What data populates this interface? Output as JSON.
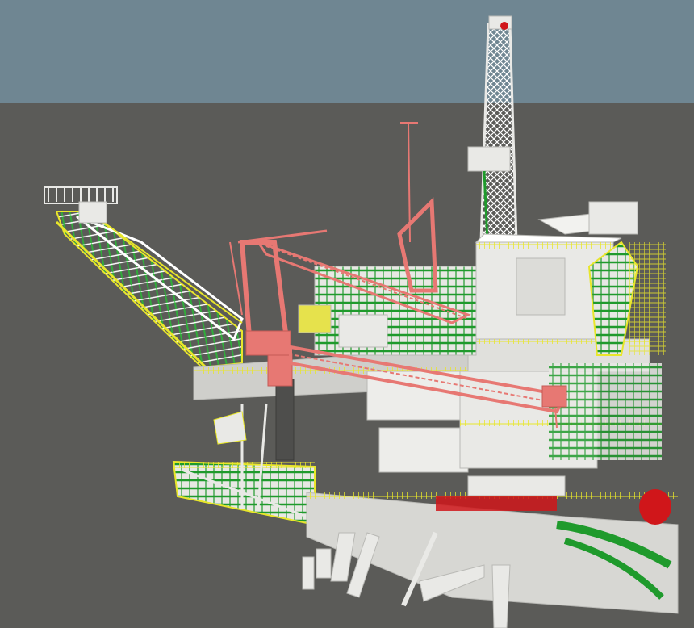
{
  "viewport": {
    "sky_color": "#6f8692",
    "ground_color": "#5b5b58"
  },
  "palette": {
    "structure": "#e9e9e6",
    "structure_shadow": "#b9b9b5",
    "railing": "#e8e62a",
    "piping": "#1f9a2c",
    "crane": "#e77873",
    "equipment_yellow": "#e6e24c",
    "vessel_red": "#d0161a"
  },
  "objects": [
    {
      "id": "drilling-derrick",
      "icon": "lattice-tower"
    },
    {
      "id": "flare-boom",
      "icon": "truss-boom"
    },
    {
      "id": "pedestal-crane-left",
      "icon": "crane"
    },
    {
      "id": "pedestal-crane-right",
      "icon": "crane"
    },
    {
      "id": "main-module",
      "icon": "building-block"
    },
    {
      "id": "jacket-legs",
      "icon": "support-legs"
    }
  ]
}
